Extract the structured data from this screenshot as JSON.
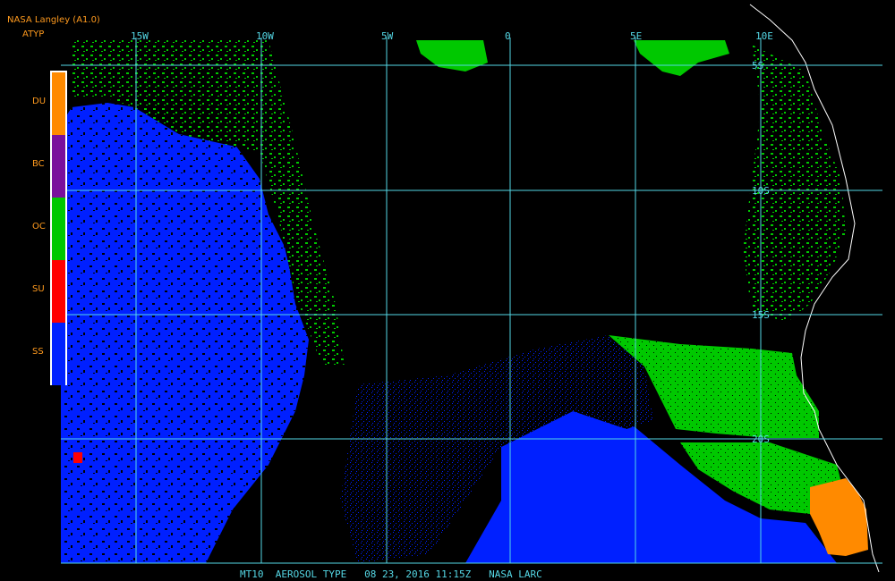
{
  "header": {
    "title": "NASA Langley (A1.0)",
    "subtitle": "ATYP"
  },
  "legend": [
    {
      "code": "DU",
      "color": "#ff8a00"
    },
    {
      "code": "BC",
      "color": "#7a0f9c"
    },
    {
      "code": "OC",
      "color": "#00c800"
    },
    {
      "code": "SU",
      "color": "#ff0000"
    },
    {
      "code": "SS",
      "color": "#0020ff"
    }
  ],
  "grid": {
    "longitudes": [
      "15W",
      "10W",
      "5W",
      "0",
      "5E",
      "10E"
    ],
    "latitudes": [
      "5S",
      "10S",
      "15S",
      "20S"
    ],
    "line_color": "#55d8e6"
  },
  "footer": "MT10  AEROSOL TYPE   08 23, 2016 11:15Z   NASA LARC"
}
